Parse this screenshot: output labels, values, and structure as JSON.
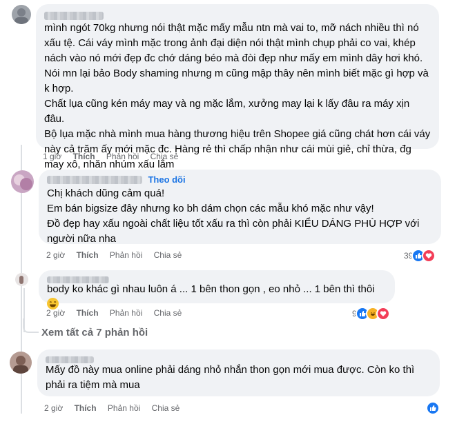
{
  "comments": [
    {
      "text_lines": [
        "mình ngót 70kg nhưng nói thật mặc mấy mẫu ntn mà vai to, mỡ nách nhiều thì nó xấu tệ. Cái váy mình mặc trong ảnh đại diện nói thật mình chụp phải co vai, khép nách vào nó mới đẹp đc chớ dáng béo mà đòi đẹp như mấy em mình dây hơi khó.",
        "Nói mn lại bảo Body shaming nhưng m cũng mập thây nên mình biết mặc gì hợp và k hợp.",
        "Chất lụa cũng kén máy may và ng mặc lắm, xưởng may lại k lấy đâu ra máy xịn đâu.",
        "Bộ lụa mặc nhà mình mua hàng thương hiệu trên Shopee giá cũng chát hơn cái váy này cả trăm ấy mới mặc đc. Hàng rẻ thì chấp nhận như cái mùi giẻ, chỉ thừa, đg may xô, nhăn nhúm xấu lắm"
      ],
      "time": "1 giờ",
      "like": "Thích",
      "reply": "Phản hồi",
      "share": "Chia sẻ"
    },
    {
      "follow": "Theo dõi",
      "text_lines": [
        "Chị khách dũng cảm quá!",
        "Em bán bigsize đây nhưng ko bh dám chọn các mẫu khó mặc như vậy!",
        "Đồ đẹp hay xấu ngoài chất liệu tốt xấu ra thì còn phải KIỂU DÁNG PHÙ HỢP với người nữa nha"
      ],
      "time": "2 giờ",
      "like": "Thích",
      "reply": "Phản hồi",
      "share": "Chia sẻ",
      "reaction_count": "39"
    },
    {
      "text": "body ko khác gì nhau luôn á ... 1 bên thon gọn , eo nhỏ ... 1 bên thì thôi",
      "time": "2 giờ",
      "like": "Thích",
      "reply": "Phản hồi",
      "share": "Chia sẻ",
      "reaction_count": "9"
    },
    {
      "view_replies": "Xem tất cả 7 phản hồi"
    },
    {
      "text": "Mấy đồ này mua online phải dáng nhỏ nhắn thon gọn mới mua được. Còn ko thì phải ra tiệm mà mua",
      "time": "2 giờ",
      "like": "Thích",
      "reply": "Phản hồi",
      "share": "Chia sẻ"
    }
  ],
  "colors": {
    "bubble": "#f0f2f5",
    "meta": "#65676b",
    "link": "#1b74e4",
    "like": "#1877f2",
    "heart": "#f33e58",
    "haha": "#f7b125"
  }
}
